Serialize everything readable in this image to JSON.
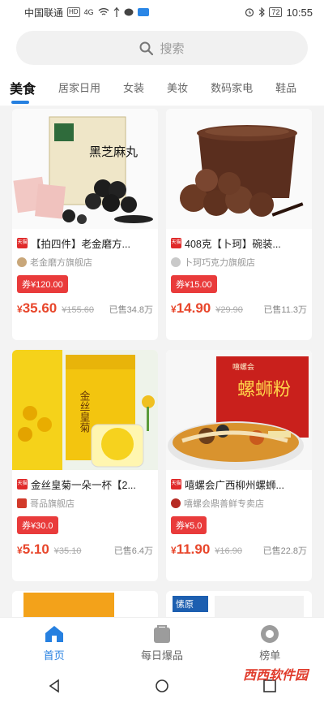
{
  "status": {
    "carrier": "中国联通",
    "badge_hd": "HD",
    "badge_4g": "4G",
    "battery": "72",
    "time": "10:55"
  },
  "search": {
    "placeholder": "搜索"
  },
  "tabs": [
    "美食",
    "居家日用",
    "女装",
    "美妆",
    "数码家电",
    "鞋品"
  ],
  "products": [
    {
      "title": "【拍四件】老金磨方...",
      "shop": "老金磨方旗舰店",
      "coupon": "券¥120.00",
      "price": "35.60",
      "orig": "¥155.60",
      "sold": "已售34.8万"
    },
    {
      "title": "408克【卜珂】碗装...",
      "shop": "卜珂巧克力旗舰店",
      "coupon": "券¥15.00",
      "price": "14.90",
      "orig": "¥29.90",
      "sold": "已售11.3万"
    },
    {
      "title": "金丝皇菊一朵一杯【2...",
      "shop": "哥品旗舰店",
      "coupon": "券¥30.0",
      "price": "5.10",
      "orig": "¥35.10",
      "sold": "已售6.4万"
    },
    {
      "title": "嘻螺会广西柳州螺蛳...",
      "shop": "嘻螺会鼎善鲜专卖店",
      "coupon": "券¥5.0",
      "price": "11.90",
      "orig": "¥16.90",
      "sold": "已售22.8万"
    }
  ],
  "product_images": {
    "p1_box_text": "黑芝麻丸",
    "p3_box_text": "金丝皇菊",
    "p4_bag_text": "螺蛳粉",
    "p4_brand": "嘻螺会",
    "partial_brand": "愫原"
  },
  "currency": "¥",
  "tmall_label": "天猫",
  "nav": [
    {
      "label": "首页",
      "icon": "home-icon"
    },
    {
      "label": "每日爆品",
      "icon": "bag-icon"
    },
    {
      "label": "榜单",
      "icon": "ranking-icon"
    }
  ],
  "watermark": "西西软件园"
}
